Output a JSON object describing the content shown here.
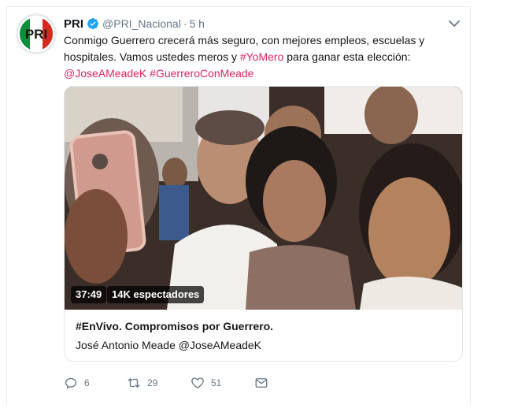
{
  "tweet": {
    "author_name": "PRI",
    "author_handle": "@PRI_Nacional",
    "separator": "·",
    "time": "5 h",
    "avatar_text": "PRI",
    "text_plain_1": "Conmigo Guerrero crecerá más seguro, con mejores empleos, escuelas y hospitales. Vamos ustedes meros y ",
    "hashtag_yomero": "#YoMero",
    "text_plain_2": " para ganar esta elección: ",
    "mention": "@JoseAMeadeK",
    "space": " ",
    "hashtag_guerrero": "#GuerreroConMeade"
  },
  "media": {
    "duration": "37:49",
    "viewers": "14K espectadores",
    "card_title": "#EnVivo. Compromisos por Guerrero.",
    "card_subtitle": "José Antonio Meade @JoseAMeadeK"
  },
  "actions": {
    "reply_count": "6",
    "retweet_count": "29",
    "like_count": "51"
  },
  "colors": {
    "link": "#e0245e",
    "verified": "#1da1f2",
    "muted": "#657786"
  },
  "icons": [
    "verified-badge-icon",
    "chevron-down-icon",
    "reply-icon",
    "retweet-icon",
    "like-icon",
    "direct-message-icon"
  ]
}
